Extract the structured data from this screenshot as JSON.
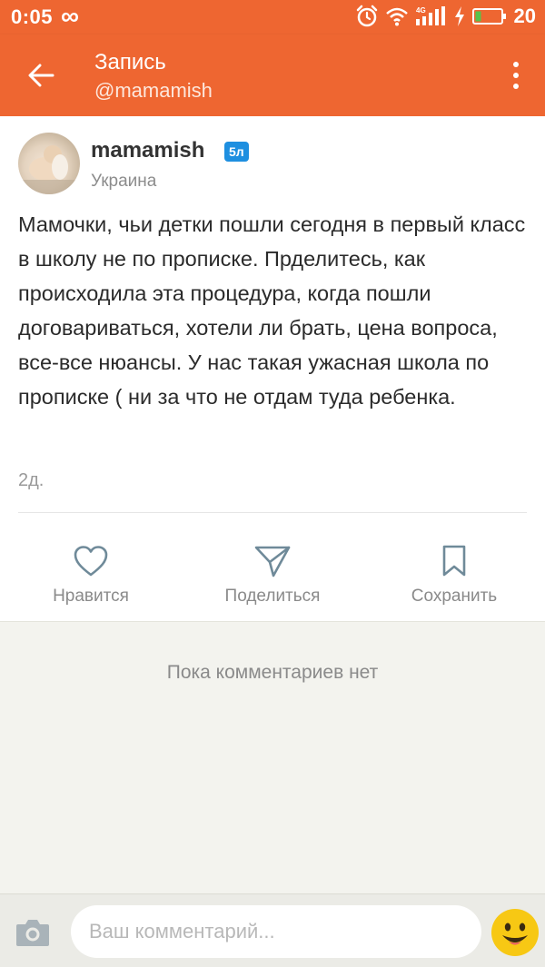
{
  "status_bar": {
    "time": "0:05",
    "infinity_symbol": "∞",
    "network_label": "4G",
    "battery_level": "20",
    "icons": [
      "alarm-icon",
      "wifi-icon",
      "signal-icon",
      "charging-icon",
      "battery-icon"
    ]
  },
  "header": {
    "title": "Запись",
    "subtitle": "@mamamish",
    "back_icon": "arrow-left-icon",
    "menu_icon": "more-vertical-icon"
  },
  "post": {
    "author": {
      "name": "mamamish",
      "badge": "5л",
      "location": "Украина"
    },
    "text": "Мамочки, чьи детки пошли сегодня в первый класс в школу не по прописке. Прделитесь, как происходила эта процедура, когда пошли договариваться, хотели ли брать, цена вопроса, все-все нюансы. У нас такая ужасная школа по прописке ( ни за что не отдам туда ребенка.",
    "time": "2д.",
    "actions": [
      {
        "label": "Нравится",
        "icon": "heart-icon"
      },
      {
        "label": "Поделиться",
        "icon": "paper-plane-icon"
      },
      {
        "label": "Сохранить",
        "icon": "bookmark-icon"
      }
    ]
  },
  "comments": {
    "empty_text": "Пока комментариев нет"
  },
  "composer": {
    "placeholder": "Ваш комментарий...",
    "camera_icon": "camera-icon",
    "emoji_icon": "emoji-icon"
  },
  "colors": {
    "brand": "#ee6631",
    "badge": "#1e8fe0",
    "background": "#f3f3ee"
  }
}
